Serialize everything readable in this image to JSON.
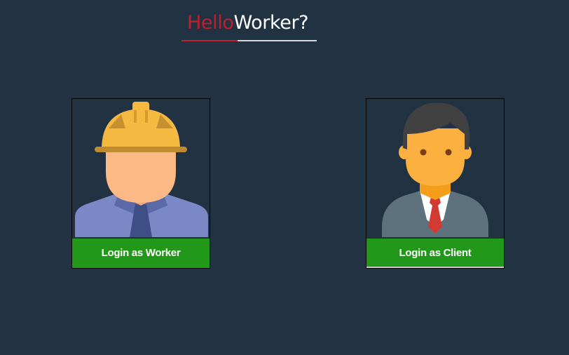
{
  "logo": {
    "part1": "Hello",
    "part2": "Worker?",
    "color_part1": "#c0202b",
    "color_part2": "#ffffff"
  },
  "cards": {
    "worker": {
      "icon": "construction-worker-icon",
      "button_label": "Login as Worker"
    },
    "client": {
      "icon": "businessman-icon",
      "button_label": "Login as Client"
    }
  },
  "colors": {
    "background": "#213243",
    "button": "#22981a"
  }
}
